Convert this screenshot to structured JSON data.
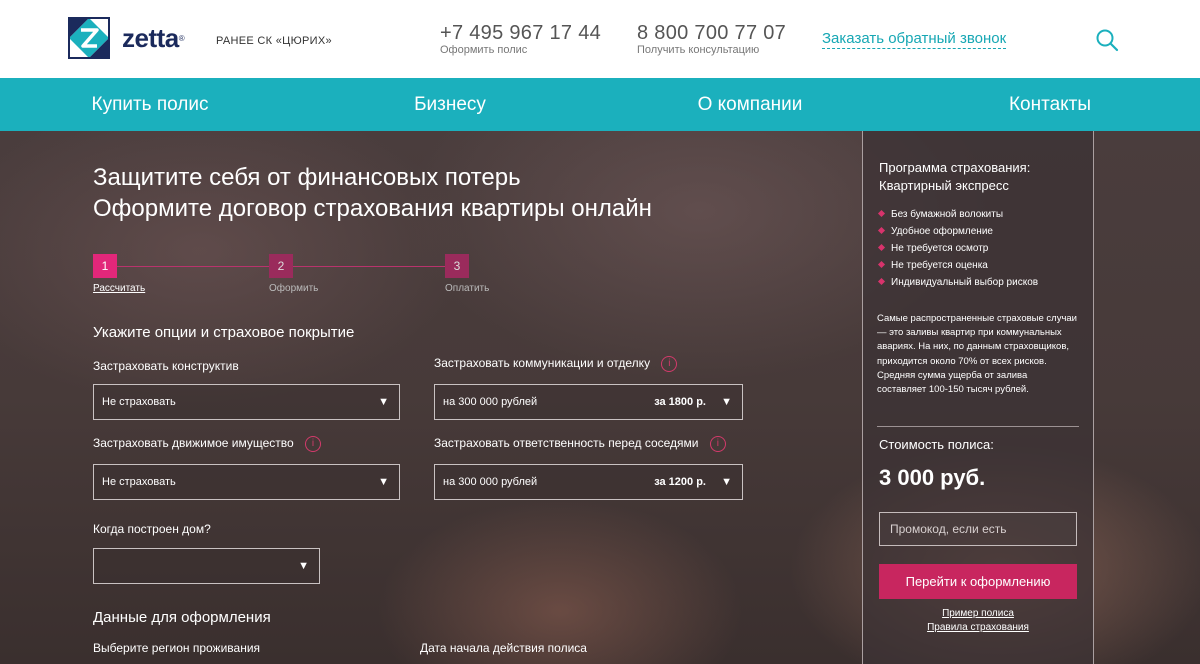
{
  "header": {
    "logo_text": "zetta",
    "former_name": "РАНЕЕ СК «ЦЮРИХ»",
    "phone1": {
      "number": "+7 495 967 17 44",
      "label": "Оформить полис"
    },
    "phone2": {
      "number": "8 800 700 77 07",
      "label": "Получить консультацию"
    },
    "callback_link": "Заказать обратный звонок"
  },
  "nav": {
    "items": [
      "Купить полис",
      "Бизнесу",
      "О компании",
      "Контакты"
    ]
  },
  "hero": {
    "title_line1": "Защитите себя от финансовых потерь",
    "title_line2": "Оформите договор страхования квартиры онлайн"
  },
  "steps": [
    {
      "num": "1",
      "label": "Рассчитать"
    },
    {
      "num": "2",
      "label": "Оформить"
    },
    {
      "num": "3",
      "label": "Оплатить"
    }
  ],
  "form": {
    "section1_title": "Укажите опции и страховое покрытие",
    "structure_label": "Застраховать конструктив",
    "structure_value": "Не страховать",
    "comms_label": "Застраховать коммуникации и отделку",
    "comms_value": "на 300 000 рублей",
    "comms_price": "за 1800 р.",
    "movable_label": "Застраховать движимое имущество",
    "movable_value": "Не страховать",
    "liability_label": "Застраховать ответственность перед соседями",
    "liability_value": "на 300 000 рублей",
    "liability_price": "за 1200 р.",
    "built_label": "Когда построен дом?",
    "built_value": "",
    "section2_title": "Данные для оформления",
    "region_label": "Выберите регион проживания",
    "start_date_label": "Дата начала действия полиса",
    "info_glyph": "i",
    "arrow_glyph": "▼"
  },
  "panel": {
    "title_line1": "Программа страхования:",
    "title_line2": "Квартирный экспресс",
    "benefits": [
      "Без бумажной волокиты",
      "Удобное оформление",
      "Не требуется осмотр",
      "Не требуется оценка",
      "Индивидуальный выбор рисков"
    ],
    "description": "Самые распространенные страховые случаи — это заливы квартир при коммунальных авариях. На них, по данным страховщиков, приходится около 70% от всех рисков. Средняя сумма ущерба от залива составляет 100-150 тысяч рублей.",
    "cost_label": "Стоимость полиса:",
    "cost_value": "3 000 руб.",
    "promo_placeholder": "Промокод, если есть",
    "cta_label": "Перейти к оформлению",
    "link_sample": "Пример полиса",
    "link_rules": "Правила страхования"
  },
  "colors": {
    "teal": "#1bb0bd",
    "pink": "#e2277a",
    "cta": "#c8265f",
    "navy": "#1b2a5c"
  }
}
